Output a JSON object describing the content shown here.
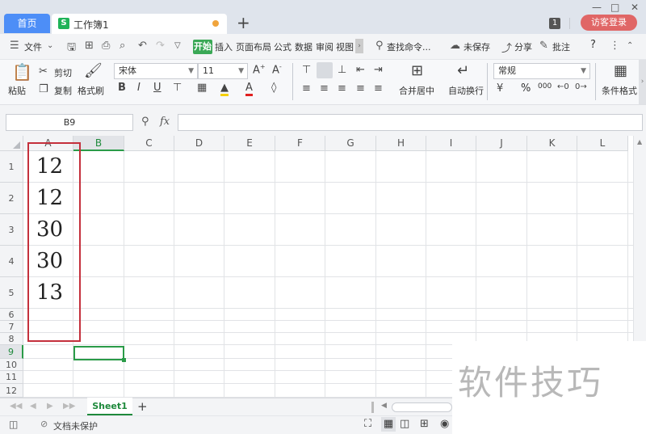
{
  "tabs": {
    "home": "首页",
    "workbook": "工作簿1",
    "plus": "+"
  },
  "titlebar": {
    "badge": "1",
    "visitor": "访客登录"
  },
  "menu": {
    "file": "文件",
    "start": "开始",
    "items": [
      "插入",
      "页面布局",
      "公式",
      "数据",
      "审阅",
      "视图"
    ],
    "search": "查找命令...",
    "unsaved": "未保存",
    "share": "分享",
    "comment": "批注",
    "help": "?"
  },
  "ribbon": {
    "paste": "粘贴",
    "cut": "剪切",
    "copy": "复制",
    "format_painter": "格式刷",
    "font": "宋体",
    "size": "11",
    "merge": "合并居中",
    "wrap": "自动换行",
    "number_format": "常规",
    "percent": "%",
    "thousands": "000",
    "cond_format": "条件格式"
  },
  "formula": {
    "cell_ref": "B9",
    "fx": "fx",
    "value": ""
  },
  "columns": [
    "A",
    "B",
    "C",
    "D",
    "E",
    "F",
    "G",
    "H",
    "I",
    "J",
    "K",
    "L"
  ],
  "rows": [
    "1",
    "2",
    "3",
    "4",
    "5",
    "6",
    "7",
    "8",
    "9",
    "10",
    "11",
    "12"
  ],
  "cells": {
    "A1": "12",
    "A2": "12",
    "A3": "30",
    "A4": "30",
    "A5": "13"
  },
  "selected_cell": "B9",
  "sheets": [
    "Sheet1"
  ],
  "status": {
    "protection": "文档未保护"
  },
  "watermark": "软件技巧",
  "colors": {
    "accent_green": "#1f8a3c",
    "tab_blue": "#4d8ef7",
    "annotation_red": "#c4303c",
    "visitor_red": "#e06666"
  }
}
